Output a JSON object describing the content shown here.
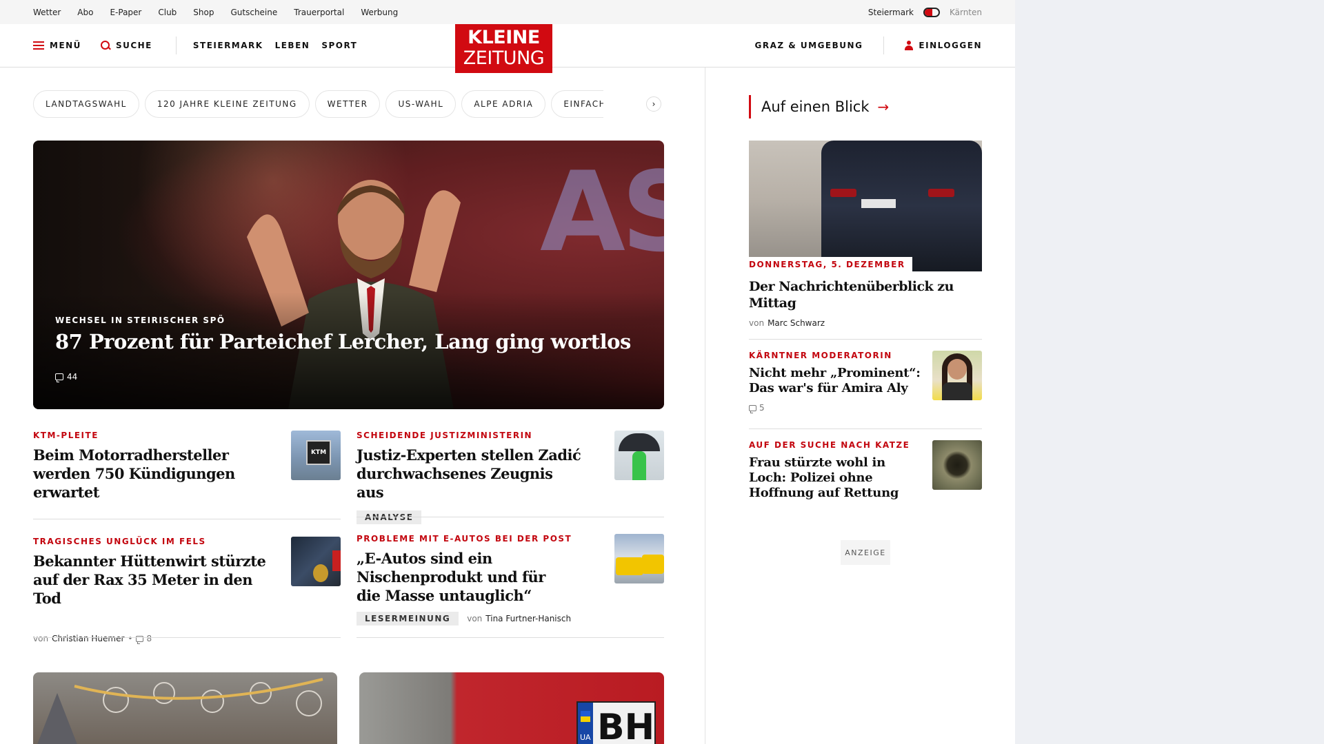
{
  "topbar": {
    "links": [
      "Wetter",
      "Abo",
      "E-Paper",
      "Club",
      "Shop",
      "Gutscheine",
      "Trauerportal",
      "Werbung"
    ],
    "region_active": "Steiermark",
    "region_inactive": "Kärnten"
  },
  "header": {
    "menu_label": "MENÜ",
    "search_label": "SUCHE",
    "nav": [
      "STEIERMARK",
      "LEBEN",
      "SPORT"
    ],
    "logo_line1": "KLEINE",
    "logo_line2": "ZEITUNG",
    "region_link": "GRAZ & UMGEBUNG",
    "login_label": "EINLOGGEN"
  },
  "tags": [
    "LANDTAGSWAHL",
    "120 JAHRE KLEINE ZEITUNG",
    "WETTER",
    "US-WAHL",
    "ALPE ADRIA",
    "EINFACHE SPRACHE"
  ],
  "hero": {
    "backdrop_text": "ASC",
    "kicker": "WECHSEL IN STEIRISCHER SPÖ",
    "title": "87 Prozent für Parteichef Lercher, Lang ging wortlos",
    "comments": "44"
  },
  "articles": [
    {
      "kicker": "KTM-PLEITE",
      "title": "Beim Motorradhersteller werden 750 Kündigungen erwartet"
    },
    {
      "kicker": "SCHEIDENDE JUSTIZMINISTERIN",
      "title": "Justiz-Experten stellen Zadić durchwachsenes Zeugnis aus",
      "badge": "ANALYSE"
    },
    {
      "kicker": "TRAGISCHES UNGLÜCK IM FELS",
      "title": "Bekannter Hüttenwirt stürzte auf der Rax 35 Meter in den Tod",
      "author_prefix": "von",
      "author": "Christian Huemer",
      "separator": "•",
      "comments": "8"
    },
    {
      "kicker": "PROBLEME MIT E-AUTOS BEI DER POST",
      "title": "„E-Autos sind ein Nischenprodukt und für die Masse untauglich“",
      "badge": "LESERMEINUNG",
      "author_prefix": "von",
      "author": "Tina Furtner-Hanisch"
    }
  ],
  "thumb_texts": {
    "ktm": "KTM",
    "plate": "BH",
    "plate_country": "UA"
  },
  "sidebar": {
    "heading": "Auf einen Blick",
    "feature": {
      "label": "DONNERSTAG, 5. DEZEMBER",
      "title": "Der Nachrichtenüberblick zu Mittag",
      "author_prefix": "von",
      "author": "Marc Schwarz"
    },
    "items": [
      {
        "kicker": "KÄRNTNER MODERATORIN",
        "title": "Nicht mehr „Prominent“: Das war's für Amira Aly",
        "comments": "5"
      },
      {
        "kicker": "AUF DER SUCHE NACH KATZE",
        "title": "Frau stürzte wohl in Loch: Polizei ohne Hoffnung auf Rettung"
      }
    ],
    "ad_label": "ANZEIGE"
  },
  "colors": {
    "brand": "#d10a11",
    "kicker": "#c3060f"
  }
}
